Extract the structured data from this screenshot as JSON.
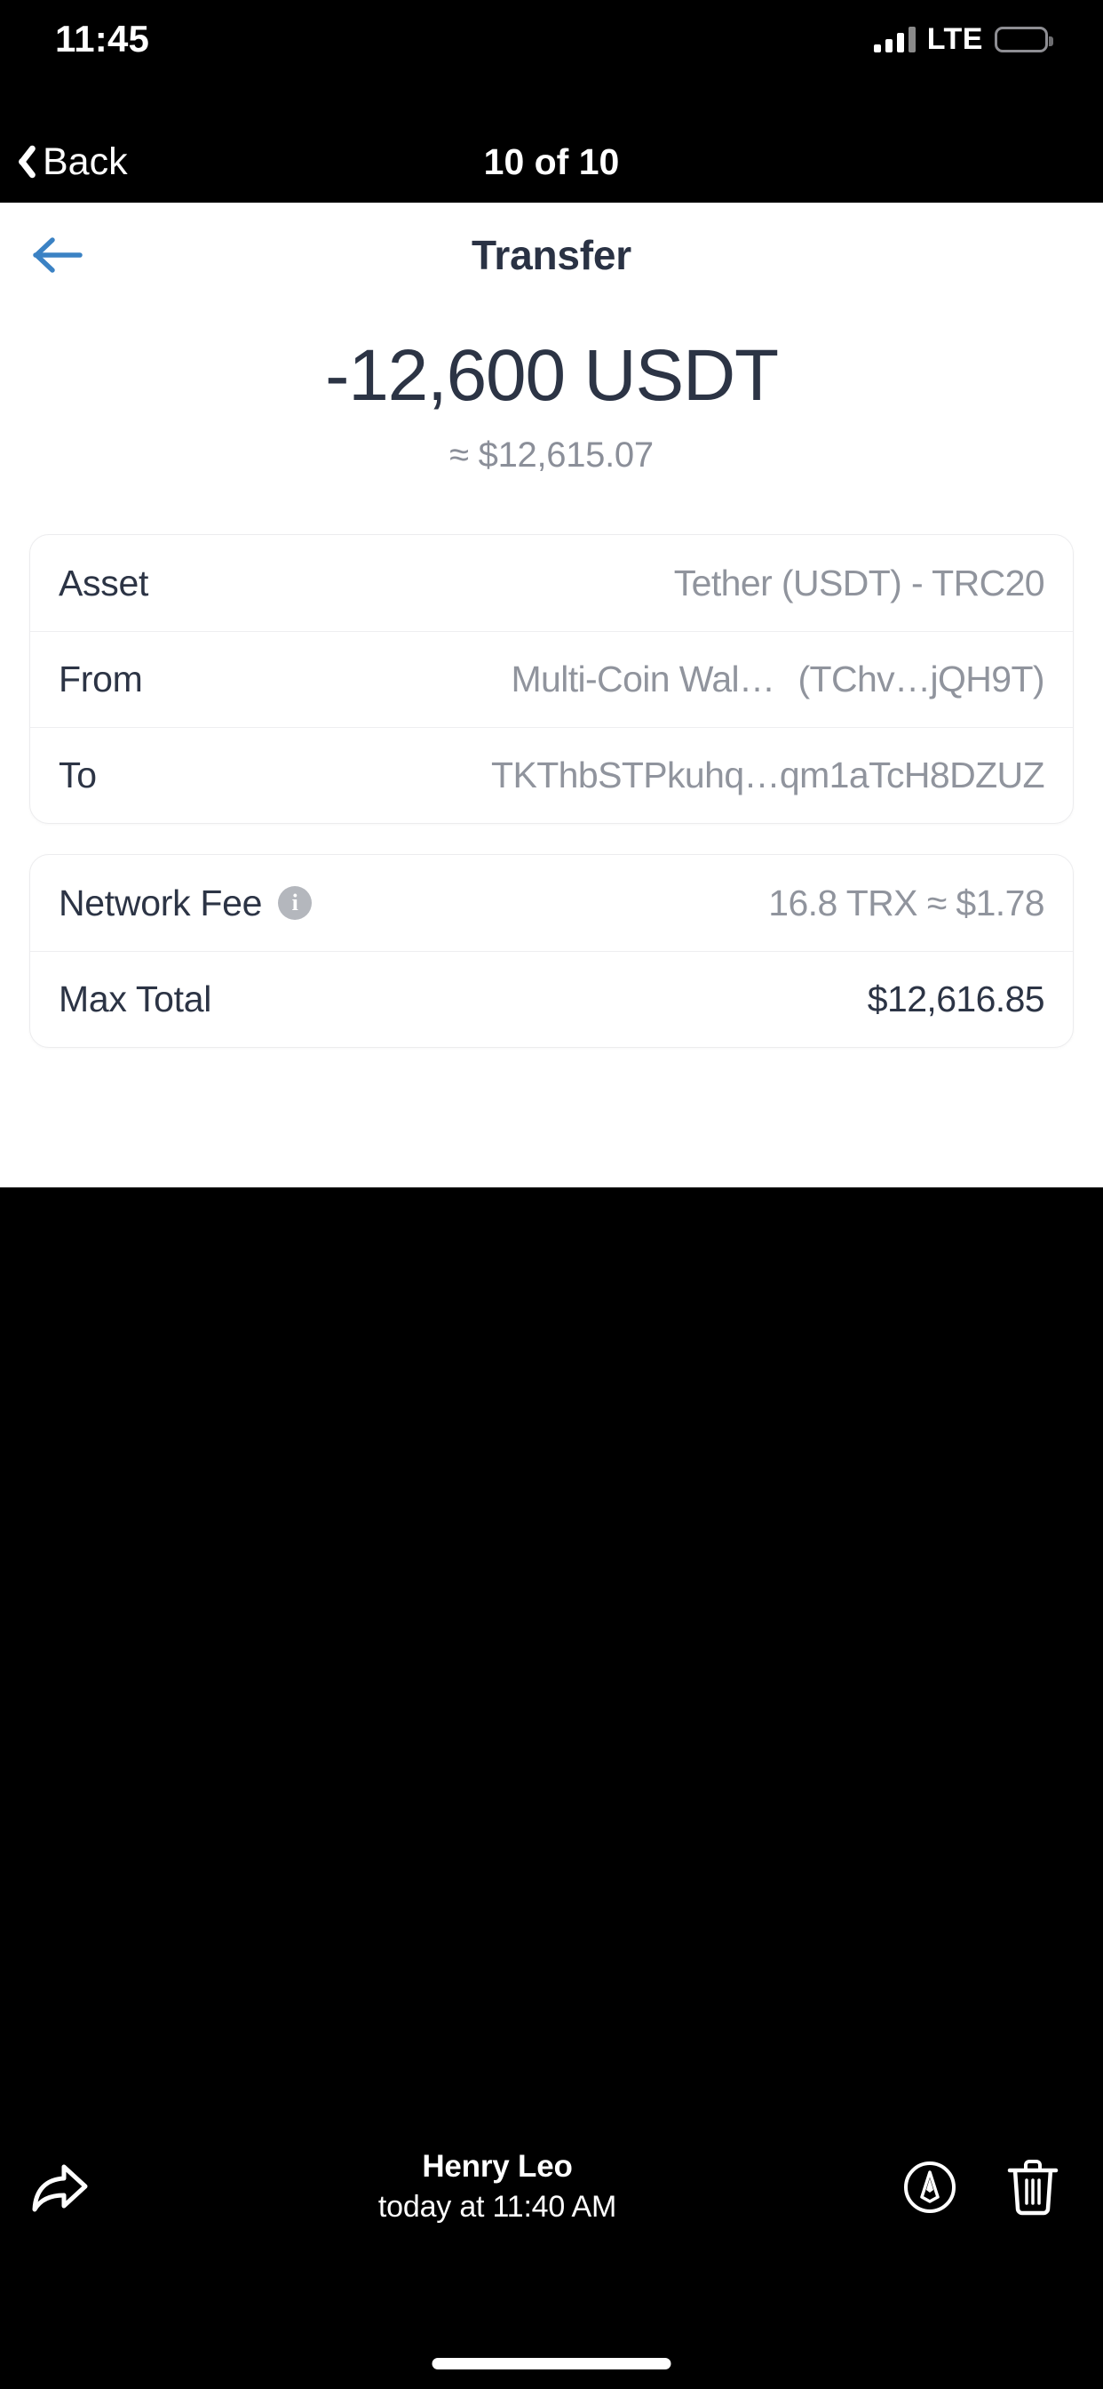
{
  "status_bar": {
    "time": "11:45",
    "network_label": "LTE",
    "battery_level_pct": 55,
    "battery_color": "#fdd23c",
    "signal_bars_filled": 3,
    "signal_bars_total": 4
  },
  "photo_viewer": {
    "back_label": "Back",
    "counter": "10 of 10",
    "back_icon": "chevron-left-icon"
  },
  "app": {
    "back_icon": "arrow-left-icon",
    "back_icon_color": "#3b82c4",
    "title": "Transfer",
    "amount": {
      "primary": "-12,600 USDT",
      "secondary": "≈ $12,615.07"
    },
    "details_card": {
      "rows": [
        {
          "label": "Asset",
          "value": "Tether (USDT) - TRC20"
        },
        {
          "label": "From",
          "value": "Multi-Coin Wal…",
          "value_extra": "(TChv…jQH9T)"
        },
        {
          "label": "To",
          "value": "TKThbSTPkuhq…qm1aTcH8DZUZ"
        }
      ]
    },
    "fee_card": {
      "rows": [
        {
          "label": "Network Fee",
          "icon": "info-icon",
          "value": "16.8 TRX ≈ $1.78"
        },
        {
          "label": "Max Total",
          "value": "$12,616.85"
        }
      ]
    }
  },
  "toolbar": {
    "share_icon": "share-forward-arrow-icon",
    "markup_icon": "markup-pen-circle-icon",
    "delete_icon": "trash-icon",
    "author_name": "Henry Leo",
    "timestamp": "today at 11:40 AM"
  },
  "colors": {
    "accent_blue": "#3b82c4",
    "text_dark": "#2c3445",
    "text_muted": "#90949d",
    "card_border": "#ececee",
    "battery_yellow": "#fdd23c"
  }
}
